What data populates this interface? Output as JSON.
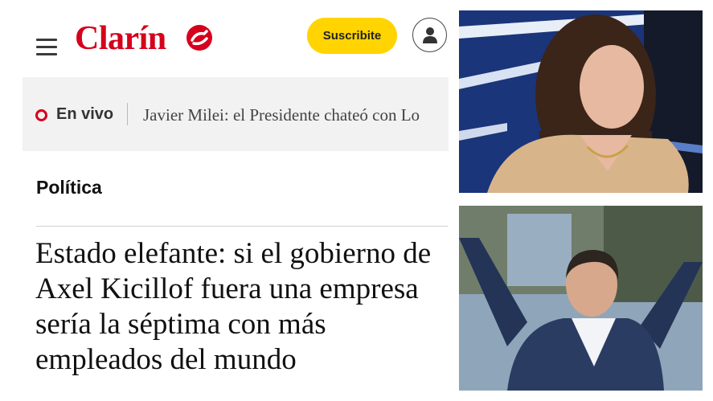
{
  "header": {
    "logo_text": "Clarín",
    "subscribe_label": "Suscribite"
  },
  "live": {
    "label": "En vivo",
    "headline": "Javier Milei: el Presidente chateó con Lo"
  },
  "article": {
    "section": "Política",
    "headline": "Estado elefante: si el gobierno de Axel Kicillof fuera una empresa sería la séptima con más empleados del mundo"
  },
  "colors": {
    "brand_red": "#d6001c",
    "subscribe_yellow": "#ffd400",
    "live_bar_bg": "#f2f2f2"
  },
  "icons": [
    "menu-icon",
    "user-icon",
    "live-dot-icon"
  ]
}
